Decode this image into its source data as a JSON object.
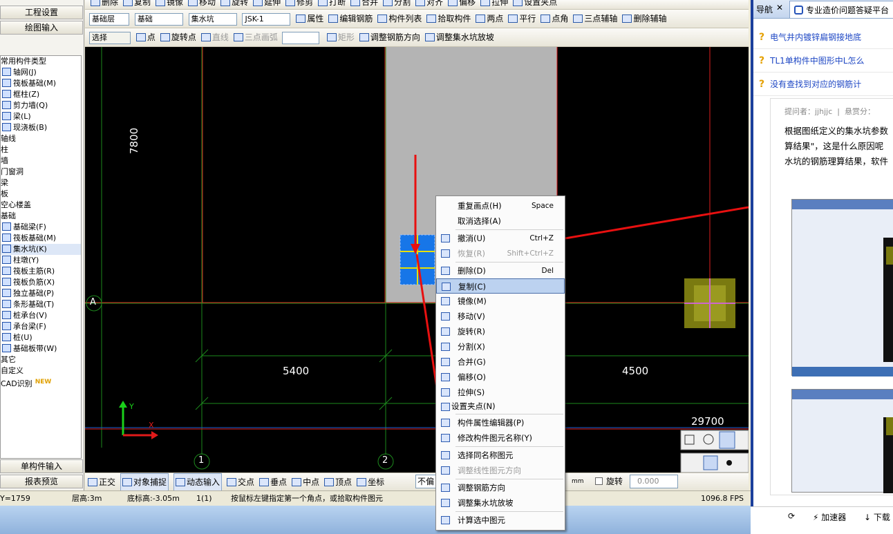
{
  "left_panel": {
    "tab1": "工程设置",
    "tab2": "绘图输入",
    "bottom1": "单构件输入",
    "bottom2": "报表预览",
    "tree": [
      {
        "label": "常用构件类型",
        "indent": 0,
        "icon": false
      },
      {
        "label": "轴网(J)",
        "indent": 1,
        "icon": true
      },
      {
        "label": "筏板基础(M)",
        "indent": 1,
        "icon": true
      },
      {
        "label": "框柱(Z)",
        "indent": 1,
        "icon": true
      },
      {
        "label": "剪力墙(Q)",
        "indent": 1,
        "icon": true
      },
      {
        "label": "梁(L)",
        "indent": 1,
        "icon": true
      },
      {
        "label": "现浇板(B)",
        "indent": 1,
        "icon": true
      },
      {
        "label": "轴线",
        "indent": 0,
        "icon": false
      },
      {
        "label": "柱",
        "indent": 0,
        "icon": false
      },
      {
        "label": "墙",
        "indent": 0,
        "icon": false
      },
      {
        "label": "门窗洞",
        "indent": 0,
        "icon": false
      },
      {
        "label": "梁",
        "indent": 0,
        "icon": false
      },
      {
        "label": "板",
        "indent": 0,
        "icon": false
      },
      {
        "label": "空心楼盖",
        "indent": 0,
        "icon": false
      },
      {
        "label": "基础",
        "indent": 0,
        "icon": false
      },
      {
        "label": "基础梁(F)",
        "indent": 1,
        "icon": true
      },
      {
        "label": "筏板基础(M)",
        "indent": 1,
        "icon": true
      },
      {
        "label": "集水坑(K)",
        "indent": 1,
        "icon": true,
        "selected": true
      },
      {
        "label": "柱墩(Y)",
        "indent": 1,
        "icon": true
      },
      {
        "label": "筏板主筋(R)",
        "indent": 1,
        "icon": true
      },
      {
        "label": "筏板负筋(X)",
        "indent": 1,
        "icon": true
      },
      {
        "label": "独立基础(P)",
        "indent": 1,
        "icon": true
      },
      {
        "label": "条形基础(T)",
        "indent": 1,
        "icon": true
      },
      {
        "label": "桩承台(V)",
        "indent": 1,
        "icon": true
      },
      {
        "label": "承台梁(F)",
        "indent": 1,
        "icon": true
      },
      {
        "label": "桩(U)",
        "indent": 1,
        "icon": true
      },
      {
        "label": "基础板带(W)",
        "indent": 1,
        "icon": true
      },
      {
        "label": "其它",
        "indent": 0,
        "icon": false
      },
      {
        "label": "自定义",
        "indent": 0,
        "icon": false
      },
      {
        "label": "CAD识别",
        "indent": 0,
        "icon": false,
        "badge": "NEW"
      }
    ]
  },
  "toolbar1": [
    "删除",
    "复制",
    "镜像",
    "移动",
    "旋转",
    "延伸",
    "修剪",
    "打断",
    "合并",
    "分割",
    "对齐",
    "偏移",
    "拉伸",
    "设置夹点"
  ],
  "toolbar2": {
    "layer": "基础层",
    "type": "基础",
    "component": "集水坑",
    "instance": "JSK-1",
    "buttons": [
      "属性",
      "编辑钢筋",
      "构件列表",
      "拾取构件",
      "两点",
      "平行",
      "点角",
      "三点辅轴",
      "删除辅轴"
    ]
  },
  "toolbar3": {
    "select": "选择",
    "items": [
      "点",
      "旋转点",
      "直线",
      "三点画弧",
      "矩形",
      "调整钢筋方向",
      "调整集水坑放坡"
    ]
  },
  "canvas": {
    "dim_7800": "7800",
    "dim_5400": "5400",
    "dim_4500": "4500",
    "dim_29700": "29700",
    "axis_a": "A",
    "axis_1": "1",
    "axis_2": "2",
    "y_label": "Y",
    "x_label": "X"
  },
  "snapbar": {
    "items": [
      "正交",
      "对象捕捉",
      "动态输入",
      "交点",
      "垂点",
      "中点",
      "顶点",
      "坐标"
    ],
    "no_offset": "不偏",
    "mm": "mm",
    "rotate": "旋转",
    "rotate_value": "0.000"
  },
  "status": {
    "coord": "Y=1759",
    "floor_height": "层高:3m",
    "base_elev": "底标高:-3.05m",
    "count": "1(1)",
    "hint": "按鼠标左键指定第一个角点，或拾取构件图元",
    "fps": "1096.8 FPS"
  },
  "context_menu": [
    {
      "label": "重复画点(H)",
      "shortcut": "Space",
      "icon": false
    },
    {
      "label": "取消选择(A)",
      "shortcut": "",
      "icon": false
    },
    {
      "sep": true
    },
    {
      "label": "撤消(U)",
      "shortcut": "Ctrl+Z",
      "icon": true
    },
    {
      "label": "恢复(R)",
      "shortcut": "Shift+Ctrl+Z",
      "icon": true,
      "disabled": true
    },
    {
      "sep": true
    },
    {
      "label": "删除(D)",
      "shortcut": "Del",
      "icon": true
    },
    {
      "label": "复制(C)",
      "shortcut": "",
      "icon": true,
      "highlight": true
    },
    {
      "label": "镜像(M)",
      "shortcut": "",
      "icon": true
    },
    {
      "label": "移动(V)",
      "shortcut": "",
      "icon": true
    },
    {
      "label": "旋转(R)",
      "shortcut": "",
      "icon": true
    },
    {
      "label": "分割(X)",
      "shortcut": "",
      "icon": true
    },
    {
      "label": "合并(G)",
      "shortcut": "",
      "icon": true
    },
    {
      "label": "偏移(O)",
      "shortcut": "",
      "icon": true
    },
    {
      "label": "拉伸(S)",
      "shortcut": "",
      "icon": true
    },
    {
      "label": "设置夹点(N)",
      "shortcut": "",
      "icon": true
    },
    {
      "sep": true
    },
    {
      "label": "构件属性编辑器(P)",
      "shortcut": "",
      "icon": true
    },
    {
      "label": "修改构件图元名称(Y)",
      "shortcut": "",
      "icon": true
    },
    {
      "sep": true
    },
    {
      "label": "选择同名称图元",
      "shortcut": "",
      "icon": true
    },
    {
      "label": "调整线性图元方向",
      "shortcut": "",
      "icon": true,
      "disabled": true
    },
    {
      "sep": true
    },
    {
      "label": "调整钢筋方向",
      "shortcut": "",
      "icon": true
    },
    {
      "label": "调整集水坑放坡",
      "shortcut": "",
      "icon": true
    },
    {
      "sep": true
    },
    {
      "label": "计算选中图元",
      "shortcut": "",
      "icon": true
    }
  ],
  "right_panel": {
    "tab_prev": "导航",
    "tab_active": "专业造价问题答疑平台",
    "questions": [
      "电气井内镀锌扁钢接地底",
      "TL1单构件中图形中L怎么",
      "没有查找到对应的钢筋计"
    ],
    "asker": "提问者：jjhjjc",
    "reward": "悬赏分：",
    "body": [
      "根据图纸定义的集水坑参数",
      "算结果\"，这是什么原因呢",
      "水坑的钢筋理算结果，软件"
    ],
    "bottom_btn1": "加速器",
    "bottom_btn2": "下载"
  }
}
